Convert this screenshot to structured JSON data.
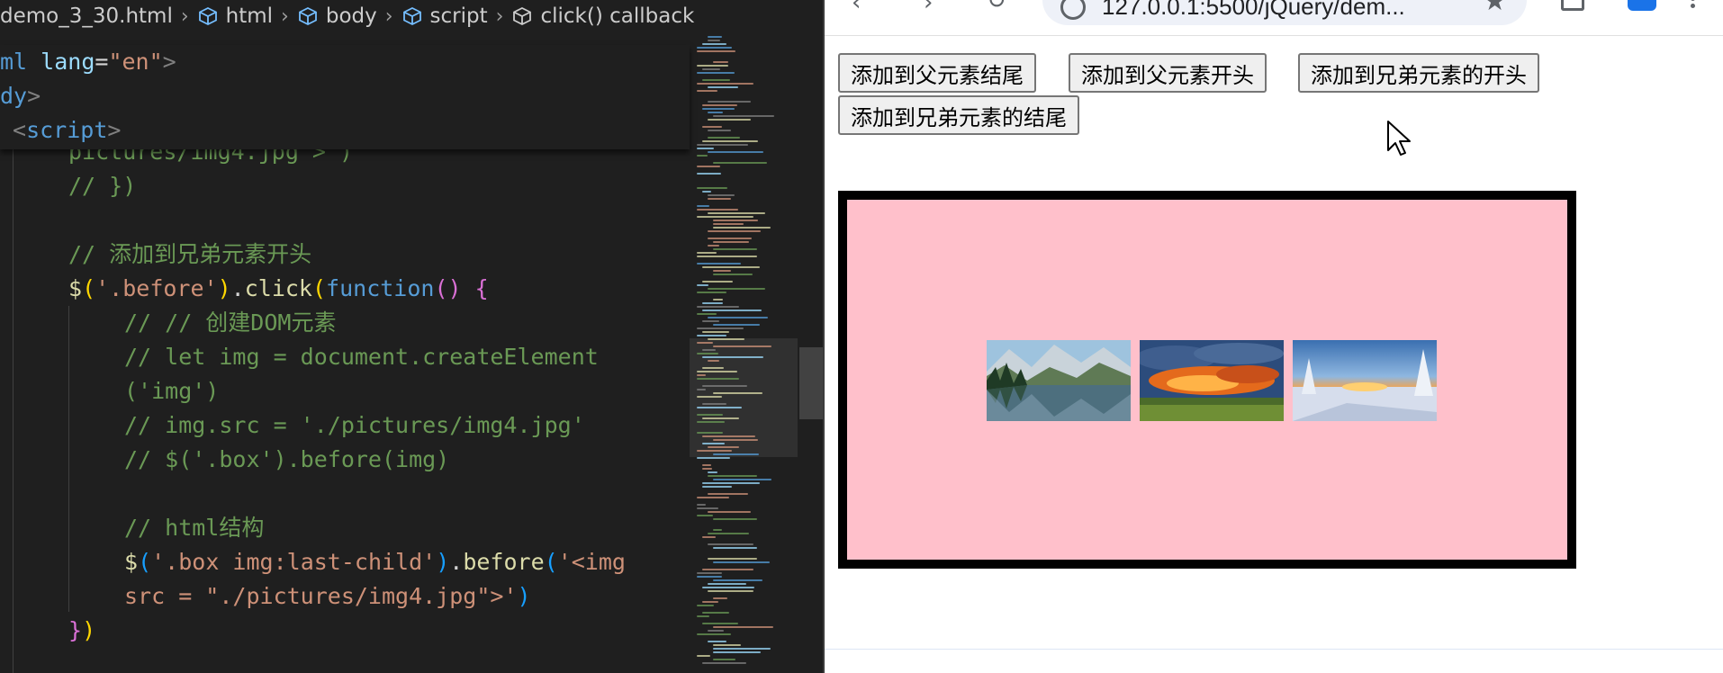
{
  "editor": {
    "breadcrumb": [
      {
        "label": "demo_3_30.html",
        "icon": ""
      },
      {
        "label": "html",
        "icon": "cube-icon"
      },
      {
        "label": "body",
        "icon": "cube-icon"
      },
      {
        "label": "script",
        "icon": "cube-icon"
      },
      {
        "label": "click() callback",
        "icon": "cube-outline-icon"
      }
    ],
    "sticky_lines": {
      "html_open": "ml",
      "lang_attr": "lang",
      "lang_value": "\"en\"",
      "body_open": "dy",
      "script_open": "script"
    },
    "code": {
      "line1": "pictures/img4.jpg\">')",
      "line2": "// })",
      "line3": "// 添加到兄弟元素开头",
      "line4_selector": "'.before'",
      "line4_method": "click",
      "line4_keyword": "function",
      "line5": "// // 创建DOM元素",
      "line6": "// let img = document.createElement",
      "line7": "('img')",
      "line8": "// img.src = './pictures/img4.jpg'",
      "line9": "// $('.box').before(img)",
      "line10": "// html结构",
      "line11_selector": "'.box img:last-child'",
      "line11_method": "before",
      "line11_str": "'<img",
      "line12_str": "src = \"./pictures/img4.jpg\">'",
      "line13": "})"
    }
  },
  "browser": {
    "url": "127.0.0.1:5500/jQuery/dem...",
    "buttons": {
      "append": "添加到父元素结尾",
      "prepend": "添加到父元素开头",
      "before": "添加到兄弟元素的开头",
      "after": "添加到兄弟元素的结尾"
    },
    "images": [
      {
        "scene": "mountain-lake"
      },
      {
        "scene": "sunset-clouds"
      },
      {
        "scene": "snowy-sunset"
      }
    ],
    "colors": {
      "box_background": "#ffc0cb",
      "box_border": "#000000"
    }
  }
}
